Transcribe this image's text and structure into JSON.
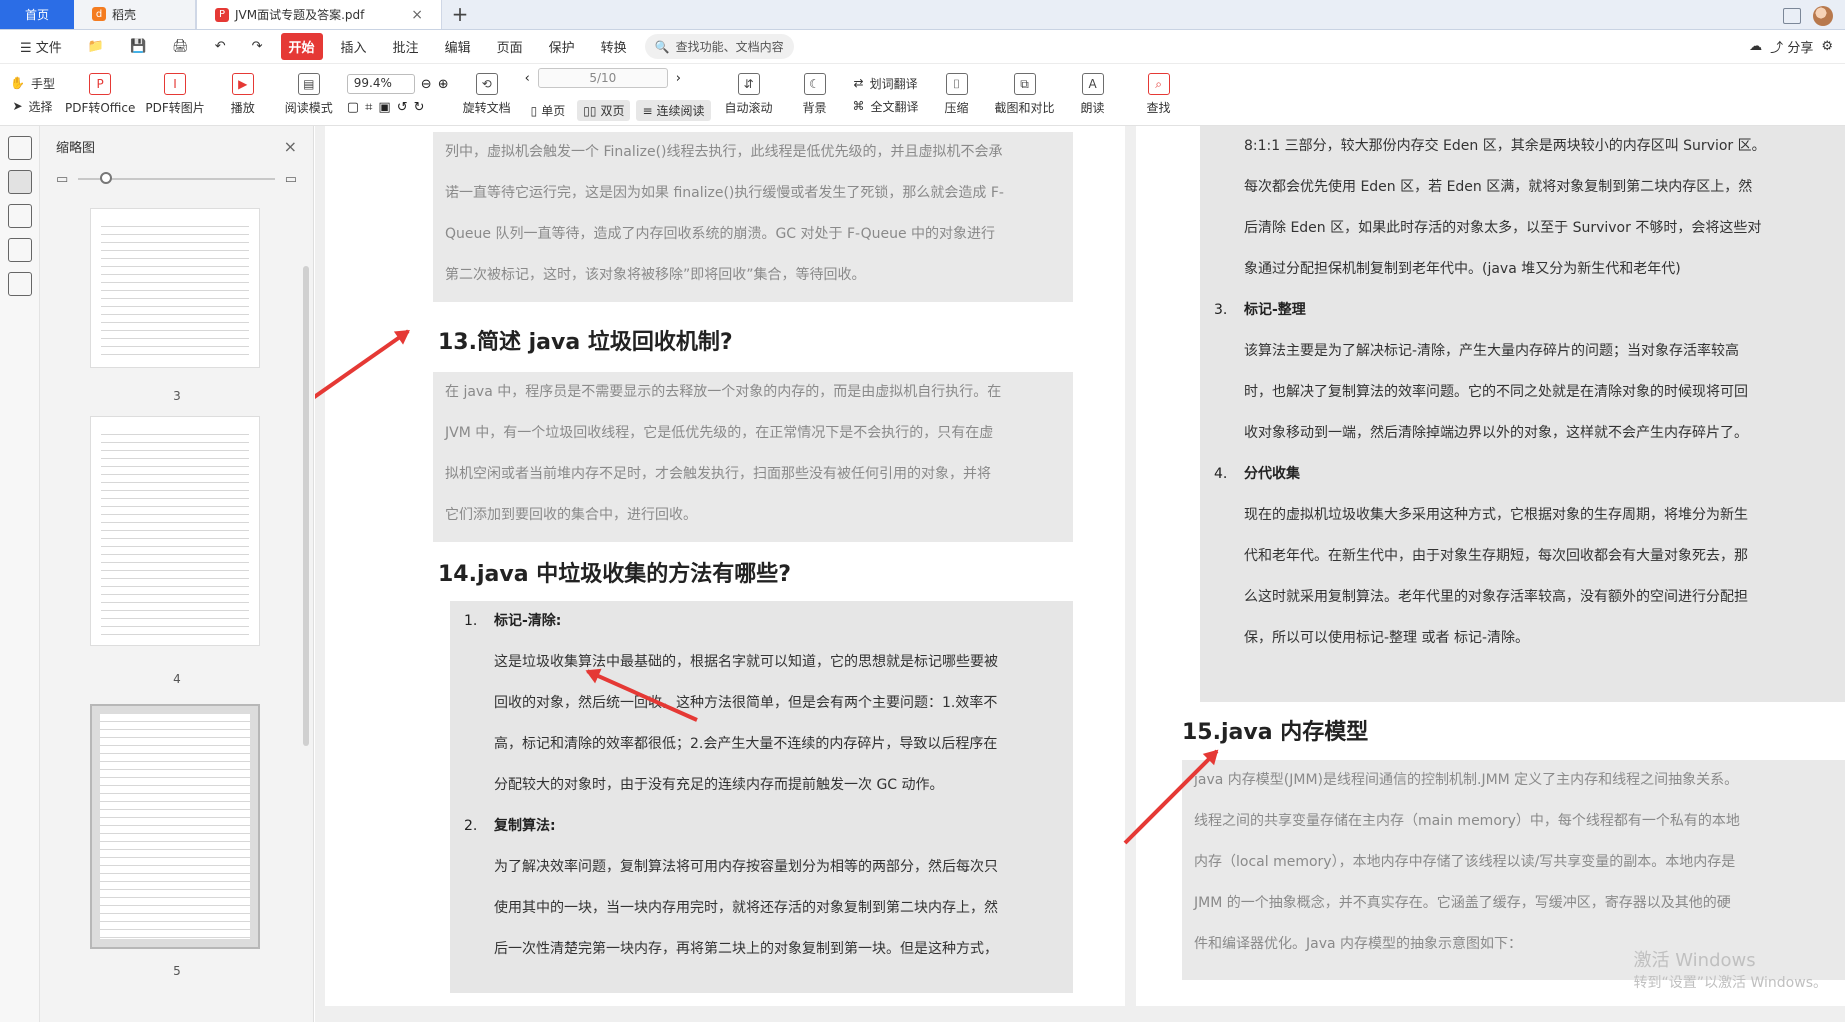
{
  "tabs": {
    "home": "首页",
    "daoke": "稻壳",
    "pdf": "JVM面试专题及答案.pdf",
    "close": "×",
    "plus": "+"
  },
  "menubar": {
    "file": "文件",
    "items": [
      "开始",
      "插入",
      "批注",
      "编辑",
      "页面",
      "保护",
      "转换"
    ],
    "search": "查找功能、文档内容",
    "share": "分享"
  },
  "ribbon": {
    "hand": "手型",
    "select": "选择",
    "pdf_to_office": "PDF转Office",
    "pdf_to_image": "PDF转图片",
    "play": "播放",
    "read_mode": "阅读模式",
    "zoom": "99.4%",
    "rotate_doc": "旋转文档",
    "page_input": "5/10",
    "single": "单页",
    "double": "双页",
    "continuous": "连续阅读",
    "auto_scroll": "自动滚动",
    "background": "背景",
    "word_translate": "划词翻译",
    "full_translate": "全文翻译",
    "compress": "压缩",
    "crop_compare": "截图和对比",
    "read_aloud": "朗读",
    "find": "查找"
  },
  "thumb": {
    "title": "缩略图",
    "close": "×",
    "pages": [
      "3",
      "4",
      "5"
    ]
  },
  "doc": {
    "left": {
      "block1": [
        "列中，虚拟机会触发一个 Finalize()线程去执行，此线程是低优先级的，并且虚拟机不会承",
        "诺一直等待它运行完，这是因为如果 finalize()执行缓慢或者发生了死锁，那么就会造成 F-",
        "Queue 队列一直等待，造成了内存回收系统的崩溃。GC 对处于 F-Queue 中的对象进行",
        "第二次被标记，这时，该对象将被移除”即将回收”集合，等待回收。"
      ],
      "h13": "13.简述 java 垃圾回收机制?",
      "block2": [
        "在 java 中，程序员是不需要显示的去释放一个对象的内存的，而是由虚拟机自行执行。在",
        "JVM 中，有一个垃圾回收线程，它是低优先级的，在正常情况下是不会执行的，只有在虚",
        "拟机空闲或者当前堆内存不足时，才会触发执行，扫面那些没有被任何引用的对象，并将",
        "它们添加到要回收的集合中，进行回收。"
      ],
      "h14": "14.java 中垃圾收集的方法有哪些?",
      "list": [
        {
          "num": "1.",
          "title": "标记-清除:",
          "lines": [
            "这是垃圾收集算法中最基础的，根据名字就可以知道，它的思想就是标记哪些要被",
            "回收的对象，然后统一回收。这种方法很简单，但是会有两个主要问题：1.效率不",
            "高，标记和清除的效率都很低；2.会产生大量不连续的内存碎片，导致以后程序在",
            "分配较大的对象时，由于没有充足的连续内存而提前触发一次 GC 动作。"
          ]
        },
        {
          "num": "2.",
          "title": "复制算法:",
          "lines": [
            "为了解决效率问题，复制算法将可用内存按容量划分为相等的两部分，然后每次只",
            "使用其中的一块，当一块内存用完时，就将还存活的对象复制到第二块内存上，然",
            "后一次性清楚完第一块内存，再将第二块上的对象复制到第一块。但是这种方式，"
          ]
        }
      ]
    },
    "right": {
      "block1": [
        "8:1:1 三部分，较大那份内存交 Eden 区，其余是两块较小的内存区叫 Survior 区。",
        "每次都会优先使用 Eden 区，若 Eden 区满，就将对象复制到第二块内存区上，然",
        "后清除 Eden 区，如果此时存活的对象太多，以至于 Survivor 不够时，会将这些对",
        "象通过分配担保机制复制到老年代中。(java 堆又分为新生代和老年代)"
      ],
      "list": [
        {
          "num": "3.",
          "title": "标记-整理",
          "lines": [
            "该算法主要是为了解决标记-清除，产生大量内存碎片的问题；当对象存活率较高",
            "时，也解决了复制算法的效率问题。它的不同之处就是在清除对象的时候现将可回",
            "收对象移动到一端，然后清除掉端边界以外的对象，这样就不会产生内存碎片了。"
          ]
        },
        {
          "num": "4.",
          "title": "分代收集",
          "lines": [
            "现在的虚拟机垃圾收集大多采用这种方式，它根据对象的生存周期，将堆分为新生",
            "代和老年代。在新生代中，由于对象生存期短，每次回收都会有大量对象死去，那",
            "么这时就采用复制算法。老年代里的对象存活率较高，没有额外的空间进行分配担",
            "保，所以可以使用标记-整理 或者 标记-清除。"
          ]
        }
      ],
      "h15": "15.java 内存模型",
      "block2": [
        "java 内存模型(JMM)是线程间通信的控制机制.JMM 定义了主内存和线程之间抽象关系。",
        "线程之间的共享变量存储在主内存（main memory）中，每个线程都有一个私有的本地",
        "内存（local memory），本地内存中存储了该线程以读/写共享变量的副本。本地内存是",
        "JMM 的一个抽象概念，并不真实存在。它涵盖了缓存，写缓冲区，寄存器以及其他的硬",
        "件和编译器优化。Java 内存模型的抽象示意图如下："
      ]
    },
    "watermark": {
      "title": "激活 Windows",
      "subtitle": "转到“设置”以激活 Windows。"
    }
  }
}
